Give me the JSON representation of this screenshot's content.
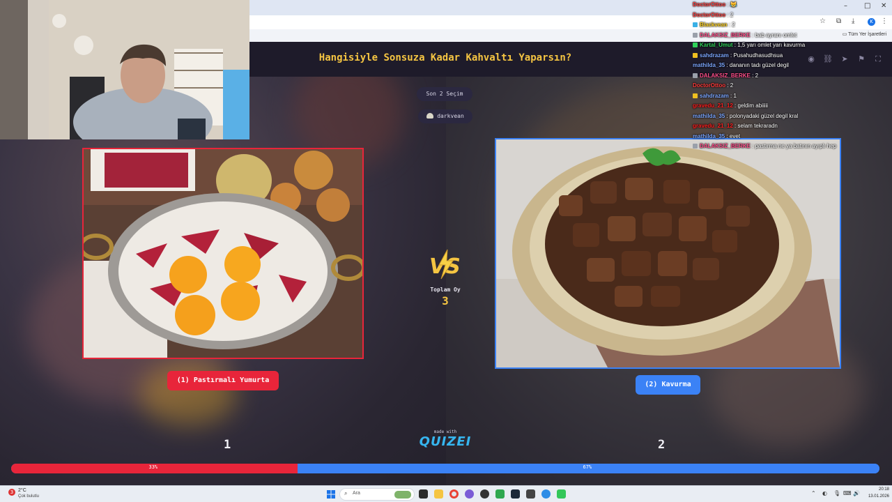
{
  "quiz": {
    "title": "Hangisiyle Sonsuza Kadar Kahvaltı Yaparsın?",
    "round_label": "Son 2 Seçim",
    "current_player": "darkvean",
    "vs_icon": "lightning-vs-icon",
    "total_votes_label": "Toplam Oy",
    "total_votes": "3",
    "made_with": "made with",
    "brand": "QUIZEI",
    "options": [
      {
        "button": "(1) Pastırmalı Yumurta",
        "score": "1",
        "percent_label": "33%",
        "percent": 33,
        "color": "#e8253a"
      },
      {
        "button": "(2) Kavurma",
        "score": "2",
        "percent_label": "67%",
        "percent": 67,
        "color": "#3b82f6"
      }
    ],
    "controls": [
      "eye-icon",
      "link-icon",
      "send-icon",
      "flag-icon",
      "fullscreen-icon"
    ]
  },
  "browser": {
    "bookmarks_label": "Tüm Yer İşaretleri"
  },
  "chat": [
    {
      "user": "DoctorOttoo",
      "message": "😹",
      "color": "#ff3b3b"
    },
    {
      "user": "DoctorOttoo",
      "message": "2",
      "color": "#ff3b3b"
    },
    {
      "user": "Blackvean",
      "message": "2",
      "color": "#ffd21f"
    },
    {
      "user": "DALAKSIZ_BERKE",
      "message": "bab ayranı omlet",
      "color": "#ff4f8b"
    },
    {
      "user": "Kartal_Umut",
      "message": "1,5 yarı omlet yarı kavurma",
      "color": "#2fd15a"
    },
    {
      "user": "sahdrazam",
      "message": "Pusahudhasudhsua",
      "color": "#7da7ff"
    },
    {
      "user": "mathilda_35",
      "message": "dananın tadı güzel degil",
      "color": "#7da7ff"
    },
    {
      "user": "DALAKSIZ_BERKE",
      "message": "2",
      "color": "#ff4f8b"
    },
    {
      "user": "DoctorOttoo",
      "message": "2",
      "color": "#ff3b3b"
    },
    {
      "user": "sahdrazam",
      "message": "1",
      "color": "#7da7ff"
    },
    {
      "user": "gravedu_21_12",
      "message": "geldim abiiiii",
      "color": "#ff2020"
    },
    {
      "user": "mathilda_35",
      "message": "polonyadaki güzel degil kral",
      "color": "#7da7ff"
    },
    {
      "user": "gravedu_21_12",
      "message": "selam tekraradn",
      "color": "#ff2020"
    },
    {
      "user": "mathilda_35",
      "message": "evet",
      "color": "#7da7ff"
    },
    {
      "user": "DALAKSIZ_BERKE",
      "message": "pastırma ne ya batının ayıplı hep",
      "color": "#ff4f8b"
    }
  ],
  "taskbar": {
    "weather_temp": "2°C",
    "weather_desc": "Çok bulutlu",
    "search_placeholder": "Ara",
    "time": "20:18",
    "date": "13.01.2026"
  }
}
